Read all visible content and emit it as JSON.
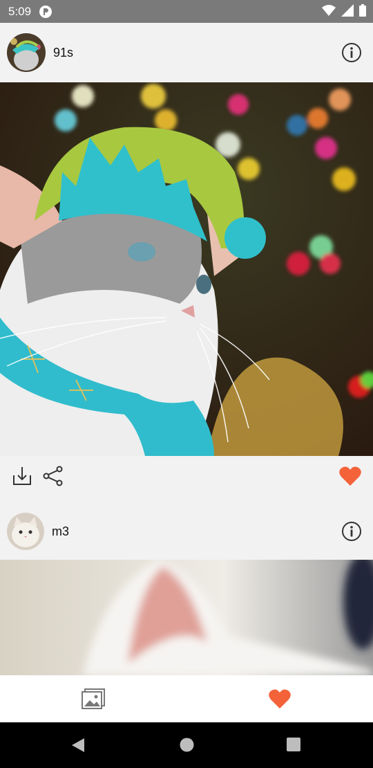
{
  "status_bar": {
    "time": "5:09"
  },
  "posts": [
    {
      "username": "91s"
    },
    {
      "username": "m3"
    }
  ],
  "colors": {
    "accent": "#f4623a",
    "status_bar": "#7a7a7a"
  },
  "icons": [
    "info-icon",
    "download-icon",
    "share-icon",
    "heart-icon",
    "gallery-icon",
    "back-icon",
    "home-icon",
    "recents-icon"
  ]
}
